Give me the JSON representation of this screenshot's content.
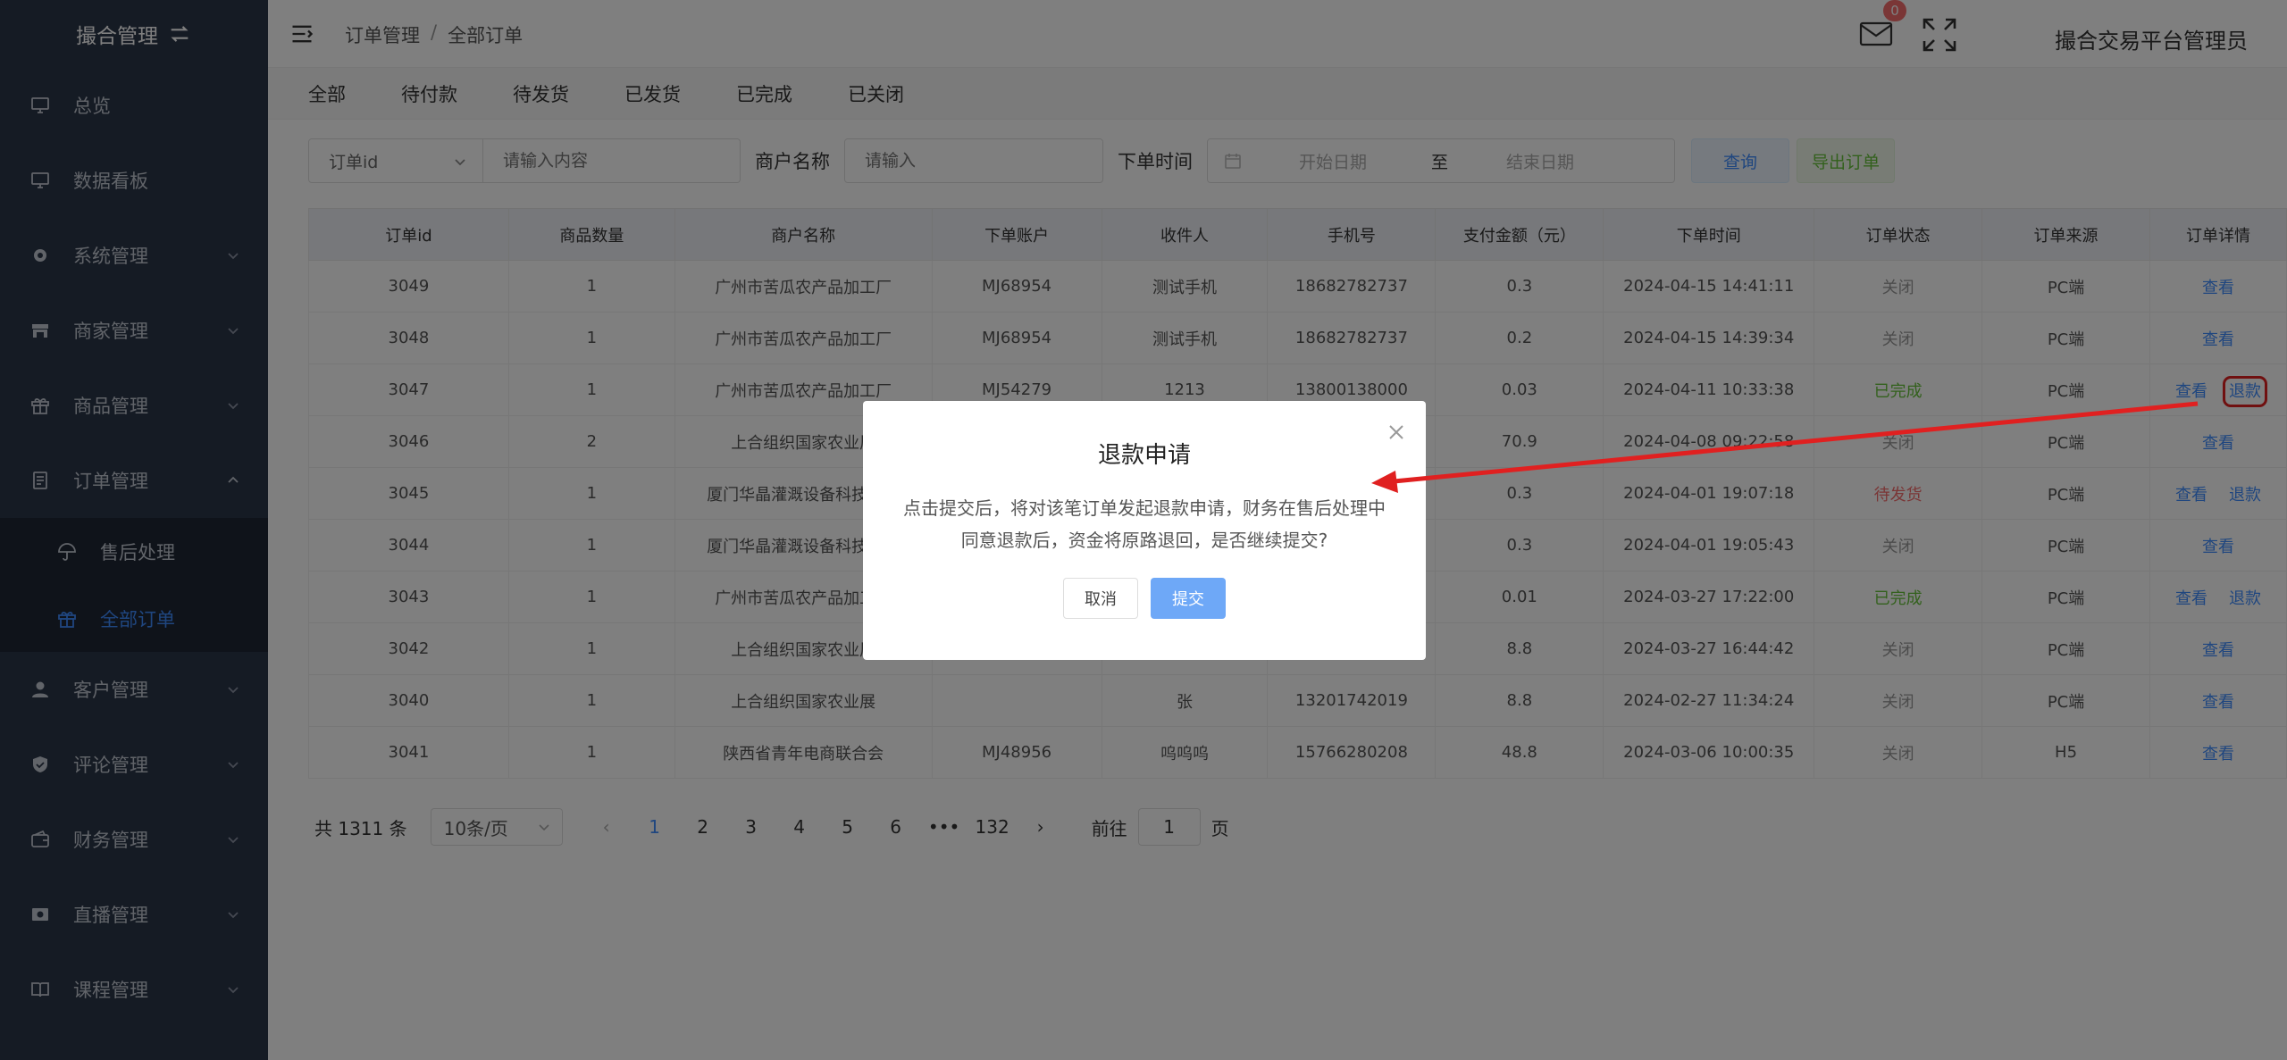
{
  "sidebar": {
    "brand": "撮合管理",
    "items": [
      {
        "label": "总览",
        "icon": "monitor-icon",
        "chevron": false
      },
      {
        "label": "数据看板",
        "icon": "monitor-icon",
        "chevron": false
      },
      {
        "label": "系统管理",
        "icon": "gear-icon",
        "chevron": true
      },
      {
        "label": "商家管理",
        "icon": "store-icon",
        "chevron": true
      },
      {
        "label": "商品管理",
        "icon": "gift-icon",
        "chevron": true
      },
      {
        "label": "订单管理",
        "icon": "document-icon",
        "chevron": true,
        "expanded": true
      }
    ],
    "sub_items": [
      {
        "label": "售后处理",
        "icon": "umbrella-icon",
        "active": false
      },
      {
        "label": "全部订单",
        "icon": "gift-icon",
        "active": true
      }
    ],
    "items_after": [
      {
        "label": "客户管理",
        "icon": "user-icon"
      },
      {
        "label": "评论管理",
        "icon": "shield-icon"
      },
      {
        "label": "财务管理",
        "icon": "wallet-icon"
      },
      {
        "label": "直播管理",
        "icon": "video-icon"
      },
      {
        "label": "课程管理",
        "icon": "book-icon"
      }
    ]
  },
  "header": {
    "breadcrumb": [
      "订单管理",
      "全部订单"
    ],
    "badge_count": "0",
    "admin_name": "撮合交易平台管理员"
  },
  "tabs": [
    "全部",
    "待付款",
    "待发货",
    "已发货",
    "已完成",
    "已关闭"
  ],
  "filter": {
    "select_value": "订单id",
    "content_placeholder": "请输入内容",
    "merchant_label": "商户名称",
    "merchant_placeholder": "请输入",
    "time_label": "下单时间",
    "start_placeholder": "开始日期",
    "to": "至",
    "end_placeholder": "结束日期",
    "query_label": "查询",
    "export_label": "导出订单"
  },
  "table": {
    "columns": [
      "订单id",
      "商品数量",
      "商户名称",
      "下单账户",
      "收件人",
      "手机号",
      "支付金额（元）",
      "下单时间",
      "订单状态",
      "订单来源",
      "订单详情"
    ],
    "view_label": "查看",
    "refund_label": "退款",
    "rows": [
      {
        "id": "3049",
        "qty": "1",
        "merchant": "广州市苦瓜农产品加工厂",
        "account": "MJ68954",
        "recipient": "测试手机",
        "phone": "18682782737",
        "amount": "0.3",
        "time": "2024-04-15 14:41:11",
        "status": "关闭",
        "status_type": "closed",
        "source": "PC端",
        "refund": false
      },
      {
        "id": "3048",
        "qty": "1",
        "merchant": "广州市苦瓜农产品加工厂",
        "account": "MJ68954",
        "recipient": "测试手机",
        "phone": "18682782737",
        "amount": "0.2",
        "time": "2024-04-15 14:39:34",
        "status": "关闭",
        "status_type": "closed",
        "source": "PC端",
        "refund": false
      },
      {
        "id": "3047",
        "qty": "1",
        "merchant": "广州市苦瓜农产品加工厂",
        "account": "MJ54279",
        "recipient": "1213",
        "phone": "13800138000",
        "amount": "0.03",
        "time": "2024-04-11 10:33:38",
        "status": "已完成",
        "status_type": "done",
        "source": "PC端",
        "refund": true,
        "highlight": true
      },
      {
        "id": "3046",
        "qty": "2",
        "merchant": "上合组织国家农业展",
        "account": "",
        "recipient": "",
        "phone": "",
        "amount": "70.9",
        "time": "2024-04-08 09:22:58",
        "status": "关闭",
        "status_type": "closed",
        "source": "PC端",
        "refund": false
      },
      {
        "id": "3045",
        "qty": "1",
        "merchant": "厦门华晶灌溉设备科技有限",
        "account": "",
        "recipient": "",
        "phone": "",
        "amount": "0.3",
        "time": "2024-04-01 19:07:18",
        "status": "待发货",
        "status_type": "pending",
        "source": "PC端",
        "refund": true
      },
      {
        "id": "3044",
        "qty": "1",
        "merchant": "厦门华晶灌溉设备科技有限",
        "account": "",
        "recipient": "",
        "phone": "",
        "amount": "0.3",
        "time": "2024-04-01 19:05:43",
        "status": "关闭",
        "status_type": "closed",
        "source": "PC端",
        "refund": false
      },
      {
        "id": "3043",
        "qty": "1",
        "merchant": "广州市苦瓜农产品加工厂",
        "account": "",
        "recipient": "",
        "phone": "",
        "amount": "0.01",
        "time": "2024-03-27 17:22:00",
        "status": "已完成",
        "status_type": "done",
        "source": "PC端",
        "refund": true
      },
      {
        "id": "3042",
        "qty": "1",
        "merchant": "上合组织国家农业展",
        "account": "",
        "recipient": "",
        "phone": "",
        "amount": "8.8",
        "time": "2024-03-27 16:44:42",
        "status": "关闭",
        "status_type": "closed",
        "source": "PC端",
        "refund": false
      },
      {
        "id": "3040",
        "qty": "1",
        "merchant": "上合组织国家农业展",
        "account": "",
        "recipient": "张",
        "phone": "13201742019",
        "amount": "8.8",
        "time": "2024-02-27 11:34:24",
        "status": "关闭",
        "status_type": "closed",
        "source": "PC端",
        "refund": false
      },
      {
        "id": "3041",
        "qty": "1",
        "merchant": "陕西省青年电商联合会",
        "account": "MJ48956",
        "recipient": "呜呜呜",
        "phone": "15766280208",
        "amount": "48.8",
        "time": "2024-03-06 10:00:35",
        "status": "关闭",
        "status_type": "closed",
        "source": "H5",
        "refund": false
      }
    ]
  },
  "pagination": {
    "total": "共 1311 条",
    "page_size": "10条/页",
    "pages": [
      "1",
      "2",
      "3",
      "4",
      "5",
      "6",
      "•••",
      "132"
    ],
    "current": "1",
    "goto_label": "前往",
    "goto_value": "1",
    "page_suffix": "页"
  },
  "dialog": {
    "title": "退款申请",
    "message": "点击提交后，将对该笔订单发起退款申请，财务在售后处理中同意退款后，资金将原路退回，是否继续提交?",
    "cancel_label": "取消",
    "submit_label": "提交"
  },
  "colors": {
    "sidebar_bg": "#2b3649",
    "accent": "#3f8cff",
    "success": "#67c23a",
    "danger": "#f56c6c",
    "annotation_red": "#e02020"
  }
}
